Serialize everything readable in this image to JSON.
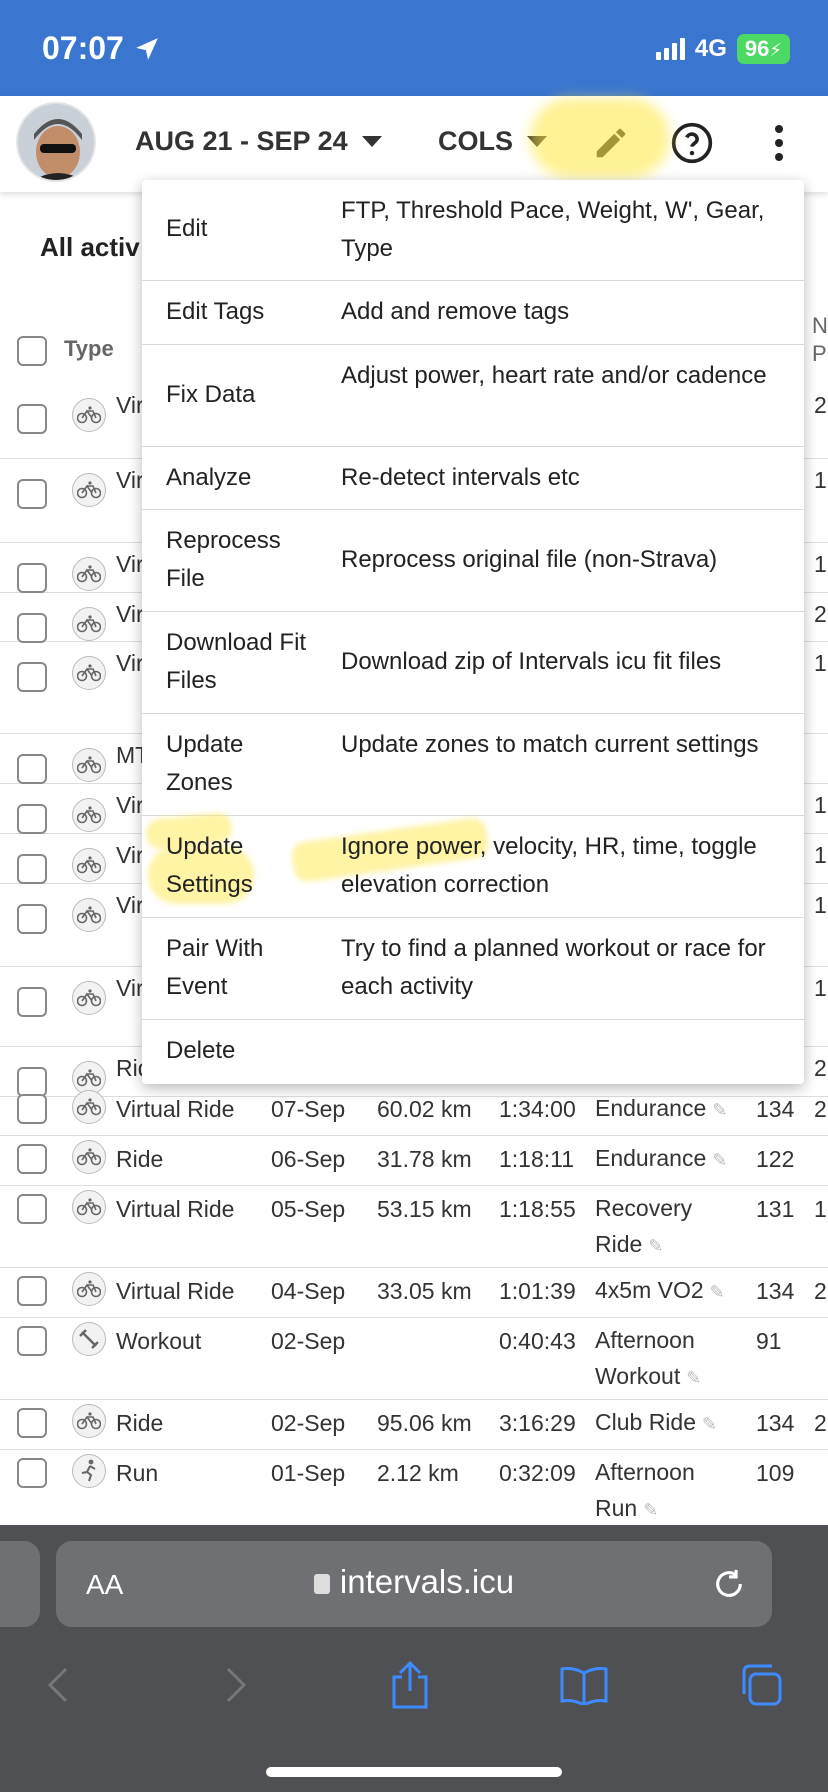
{
  "status_bar": {
    "time": "07:07",
    "network": "4G",
    "battery": "96"
  },
  "toolbar": {
    "date_range": "AUG 21 - SEP 24",
    "cols_label": "COLS"
  },
  "page": {
    "section_title": "All activ",
    "type_header": "Type",
    "n_header": "N\nP"
  },
  "menu": {
    "items": [
      {
        "label": "Edit",
        "desc": "FTP, Threshold Pace, Weight, W', Gear, Type"
      },
      {
        "label": "Edit Tags",
        "desc": "Add and remove tags"
      },
      {
        "label": "Fix Data",
        "desc": "Adjust power, heart rate and/or cadence"
      },
      {
        "label": "Analyze",
        "desc": "Re-detect intervals etc"
      },
      {
        "label": "Reprocess File",
        "desc": "Reprocess original file (non-Strava)"
      },
      {
        "label": "Download Fit Files",
        "desc": "Download zip of Intervals icu fit files"
      },
      {
        "label": "Update Zones",
        "desc": "Update zones to match current settings"
      },
      {
        "label": "Update Settings",
        "desc": "Ignore power, velocity, HR, time, toggle elevation correction"
      },
      {
        "label": "Pair With Event",
        "desc": "Try to find a planned workout or race for each activity"
      },
      {
        "label": "Delete",
        "desc": ""
      }
    ]
  },
  "hidden_rows": [
    {
      "type": "Vir",
      "n": "2"
    },
    {
      "type": "Vir",
      "n": "1"
    },
    {
      "type": "Vir",
      "n": "1"
    },
    {
      "type": "Vir",
      "n": "2"
    },
    {
      "type": "Vir",
      "n": "1"
    },
    {
      "type": "MT",
      "n": ""
    },
    {
      "type": "Vir",
      "n": "1"
    },
    {
      "type": "Vir",
      "n": "1"
    },
    {
      "type": "Vir",
      "n": "1"
    },
    {
      "type": "Vir",
      "n": "1"
    },
    {
      "type": "Rid",
      "n": "2"
    }
  ],
  "activities": [
    {
      "type": "Virtual Ride",
      "date": "07-Sep",
      "distance": "60.02 km",
      "time": "1:34:00",
      "name": "Endurance",
      "hr": "134",
      "extra": "2"
    },
    {
      "type": "Ride",
      "date": "06-Sep",
      "distance": "31.78 km",
      "time": "1:18:11",
      "name": "Endurance",
      "hr": "122",
      "extra": ""
    },
    {
      "type": "Virtual Ride",
      "date": "05-Sep",
      "distance": "53.15 km",
      "time": "1:18:55",
      "name": "Recovery Ride",
      "hr": "131",
      "extra": "1"
    },
    {
      "type": "Virtual Ride",
      "date": "04-Sep",
      "distance": "33.05 km",
      "time": "1:01:39",
      "name": "4x5m VO2",
      "hr": "134",
      "extra": "2"
    },
    {
      "type": "Workout",
      "date": "02-Sep",
      "distance": "",
      "time": "0:40:43",
      "name": "Afternoon Workout",
      "hr": "91",
      "extra": ""
    },
    {
      "type": "Ride",
      "date": "02-Sep",
      "distance": "95.06 km",
      "time": "3:16:29",
      "name": "Club Ride",
      "hr": "134",
      "extra": "2"
    },
    {
      "type": "Run",
      "date": "01-Sep",
      "distance": "2.12 km",
      "time": "0:32:09",
      "name": "Afternoon Run",
      "hr": "109",
      "extra": ""
    }
  ],
  "safari": {
    "text_size": "AA",
    "url": "intervals.icu"
  },
  "colors": {
    "status_bar": "#3a76cf",
    "highlight": "#ffe83c"
  }
}
